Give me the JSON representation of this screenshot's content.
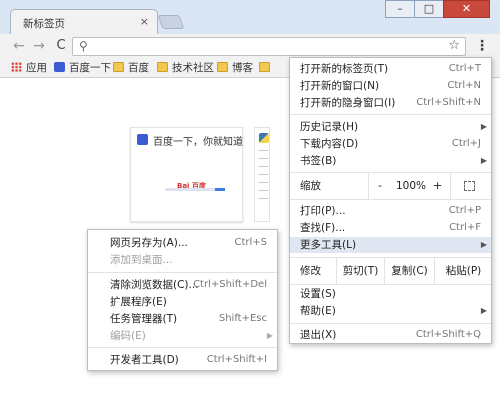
{
  "tab": {
    "title": "新标签页",
    "close_glyph": "×"
  },
  "window": {
    "min_glyph": "–",
    "max_glyph": "□",
    "close_glyph": "✕"
  },
  "toolbar": {
    "back_glyph": "←",
    "forward_glyph": "→",
    "reload_glyph": "C",
    "search_glyph": "⚲",
    "star_glyph": "☆",
    "menu_glyph": "⋮"
  },
  "bookmarks": [
    {
      "label": "应用",
      "icon": "apps-icon"
    },
    {
      "label": "百度一下",
      "icon": "baidu-paw-icon"
    },
    {
      "label": "百度",
      "icon": "folder-icon"
    },
    {
      "label": "技术社区",
      "icon": "folder-icon"
    },
    {
      "label": "博客",
      "icon": "folder-icon"
    },
    {
      "label": "",
      "icon": "folder-icon"
    }
  ],
  "thumbnail": {
    "title": "百度一下，你就知道",
    "logo": "Bai 百度"
  },
  "main_menu": {
    "new_tab": {
      "label": "打开新的标签页(T)",
      "shortcut": "Ctrl+T"
    },
    "new_window": {
      "label": "打开新的窗口(N)",
      "shortcut": "Ctrl+N"
    },
    "new_incognito": {
      "label": "打开新的隐身窗口(I)",
      "shortcut": "Ctrl+Shift+N"
    },
    "history": {
      "label": "历史记录(H)"
    },
    "downloads": {
      "label": "下载内容(D)",
      "shortcut": "Ctrl+J"
    },
    "bookmarks": {
      "label": "书签(B)"
    },
    "zoom": {
      "label": "缩放",
      "minus": "-",
      "value": "100%",
      "plus": "+"
    },
    "print": {
      "label": "打印(P)...",
      "shortcut": "Ctrl+P"
    },
    "find": {
      "label": "查找(F)...",
      "shortcut": "Ctrl+F"
    },
    "more_tools": {
      "label": "更多工具(L)"
    },
    "edit": {
      "label": "修改",
      "cut": "剪切(T)",
      "copy": "复制(C)",
      "paste": "粘贴(P)"
    },
    "settings": {
      "label": "设置(S)"
    },
    "help": {
      "label": "帮助(E)"
    },
    "exit": {
      "label": "退出(X)",
      "shortcut": "Ctrl+Shift+Q"
    }
  },
  "sub_menu": {
    "save_as": {
      "label": "网页另存为(A)...",
      "shortcut": "Ctrl+S"
    },
    "add_desktop": {
      "label": "添加到桌面..."
    },
    "clear_data": {
      "label": "清除浏览数据(C)...",
      "shortcut": "Ctrl+Shift+Del"
    },
    "extensions": {
      "label": "扩展程序(E)"
    },
    "task_manager": {
      "label": "任务管理器(T)",
      "shortcut": "Shift+Esc"
    },
    "encoding": {
      "label": "编码(E)"
    },
    "devtools": {
      "label": "开发者工具(D)",
      "shortcut": "Ctrl+Shift+I"
    }
  },
  "arrow_glyph": "▶",
  "colors": {
    "titlebar": "#dbe6f4",
    "highlight": "#e0e6f2",
    "close": "#c94a3c"
  }
}
